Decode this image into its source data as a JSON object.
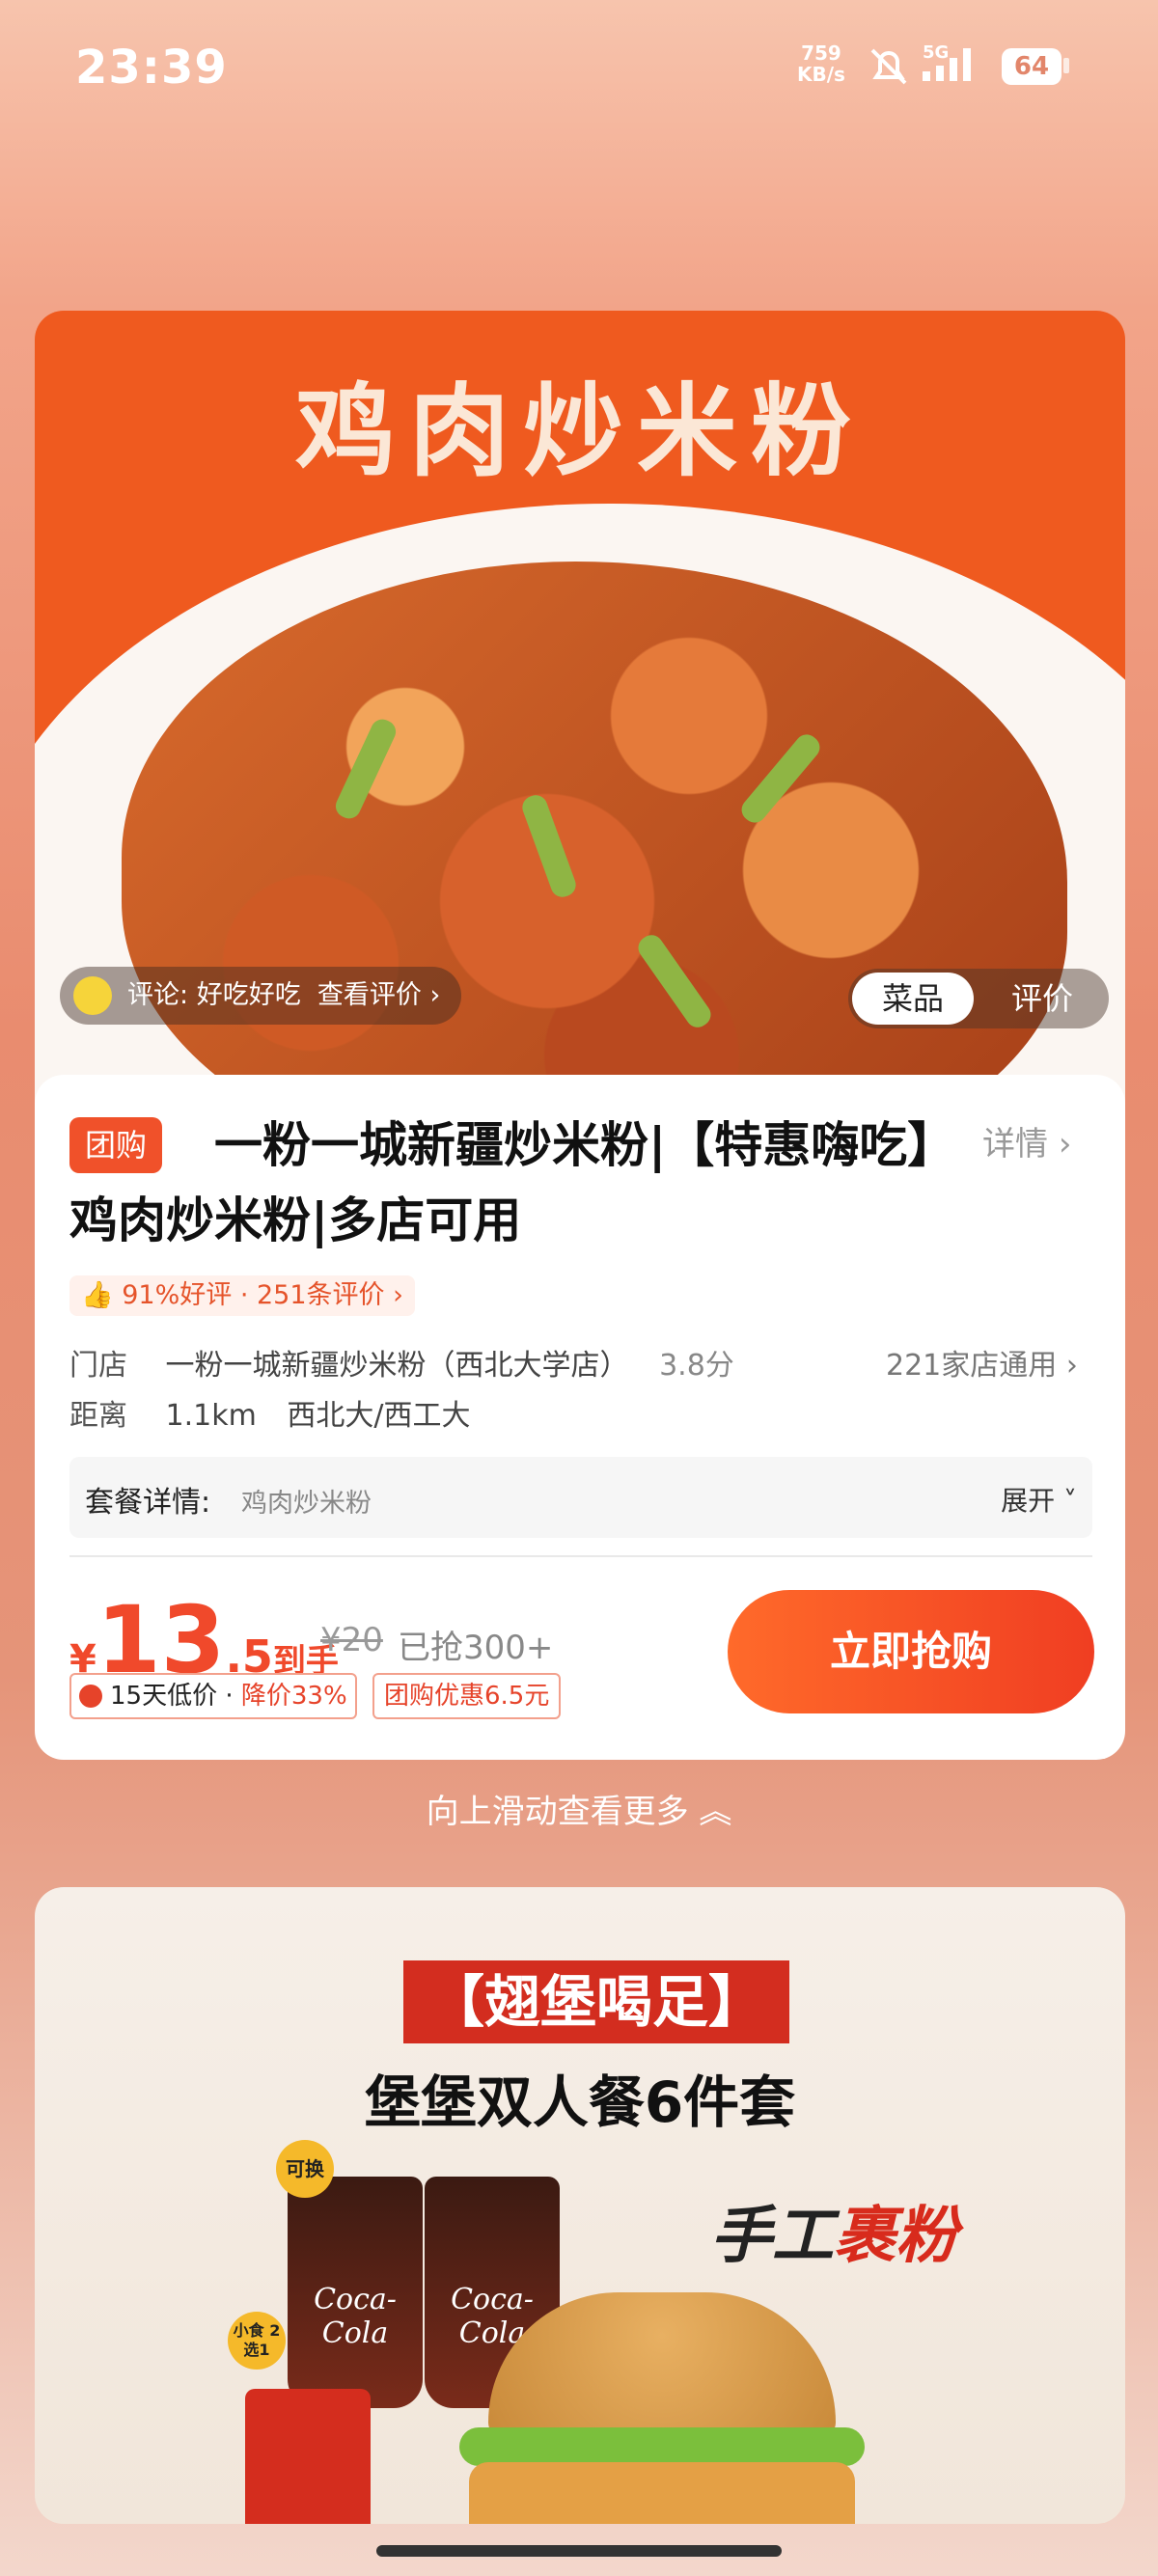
{
  "status_bar": {
    "time": "23:39",
    "net_speed_value": "759",
    "net_speed_unit": "KB/s",
    "network": "5G",
    "battery": "64"
  },
  "hero": {
    "banner_title": "鸡肉炒米粉",
    "review_prefix": "评论:",
    "review_text": "好吃好吃",
    "review_link": "查看评价",
    "tabs": [
      "菜品",
      "评价"
    ]
  },
  "deal": {
    "tag": "团购",
    "title": "一粉一城新疆炒米粉|【特惠嗨吃】鸡肉炒米粉|多店可用",
    "detail_link": "详情",
    "rating": "91%好评 · 251条评价",
    "store_label": "门店",
    "store_name": "一粉一城新疆炒米粉（西北大学店）",
    "store_score": "3.8分",
    "stores_count": "221家店通用",
    "distance_label": "距离",
    "distance_value": "1.1km",
    "area": "西北大/西工大",
    "package_label": "套餐详情:",
    "package_value": "鸡肉炒米粉",
    "expand": "展开",
    "price_currency": "¥",
    "price_int": "13",
    "price_dec": ".5",
    "price_suffix": "到手",
    "original_price": "¥20",
    "sold": "已抢300+",
    "badge_low_price": "15天低价",
    "badge_discount": "降价33%",
    "badge_group": "团购优惠6.5元",
    "buy_button": "立即抢购"
  },
  "swipe_hint": "向上滑动查看更多",
  "promo": {
    "headline": "【翅堡喝足】",
    "subtitle": "堡堡双人餐6件套",
    "tag_swap": "可换",
    "tag_snack": "小食 2选1",
    "cup_label": "Coca-Cola",
    "handwriting_a": "手工",
    "handwriting_b": "裹粉"
  },
  "colors": {
    "accent": "#f0492b",
    "button_start": "#ff6a2a",
    "button_end": "#f03e22"
  }
}
